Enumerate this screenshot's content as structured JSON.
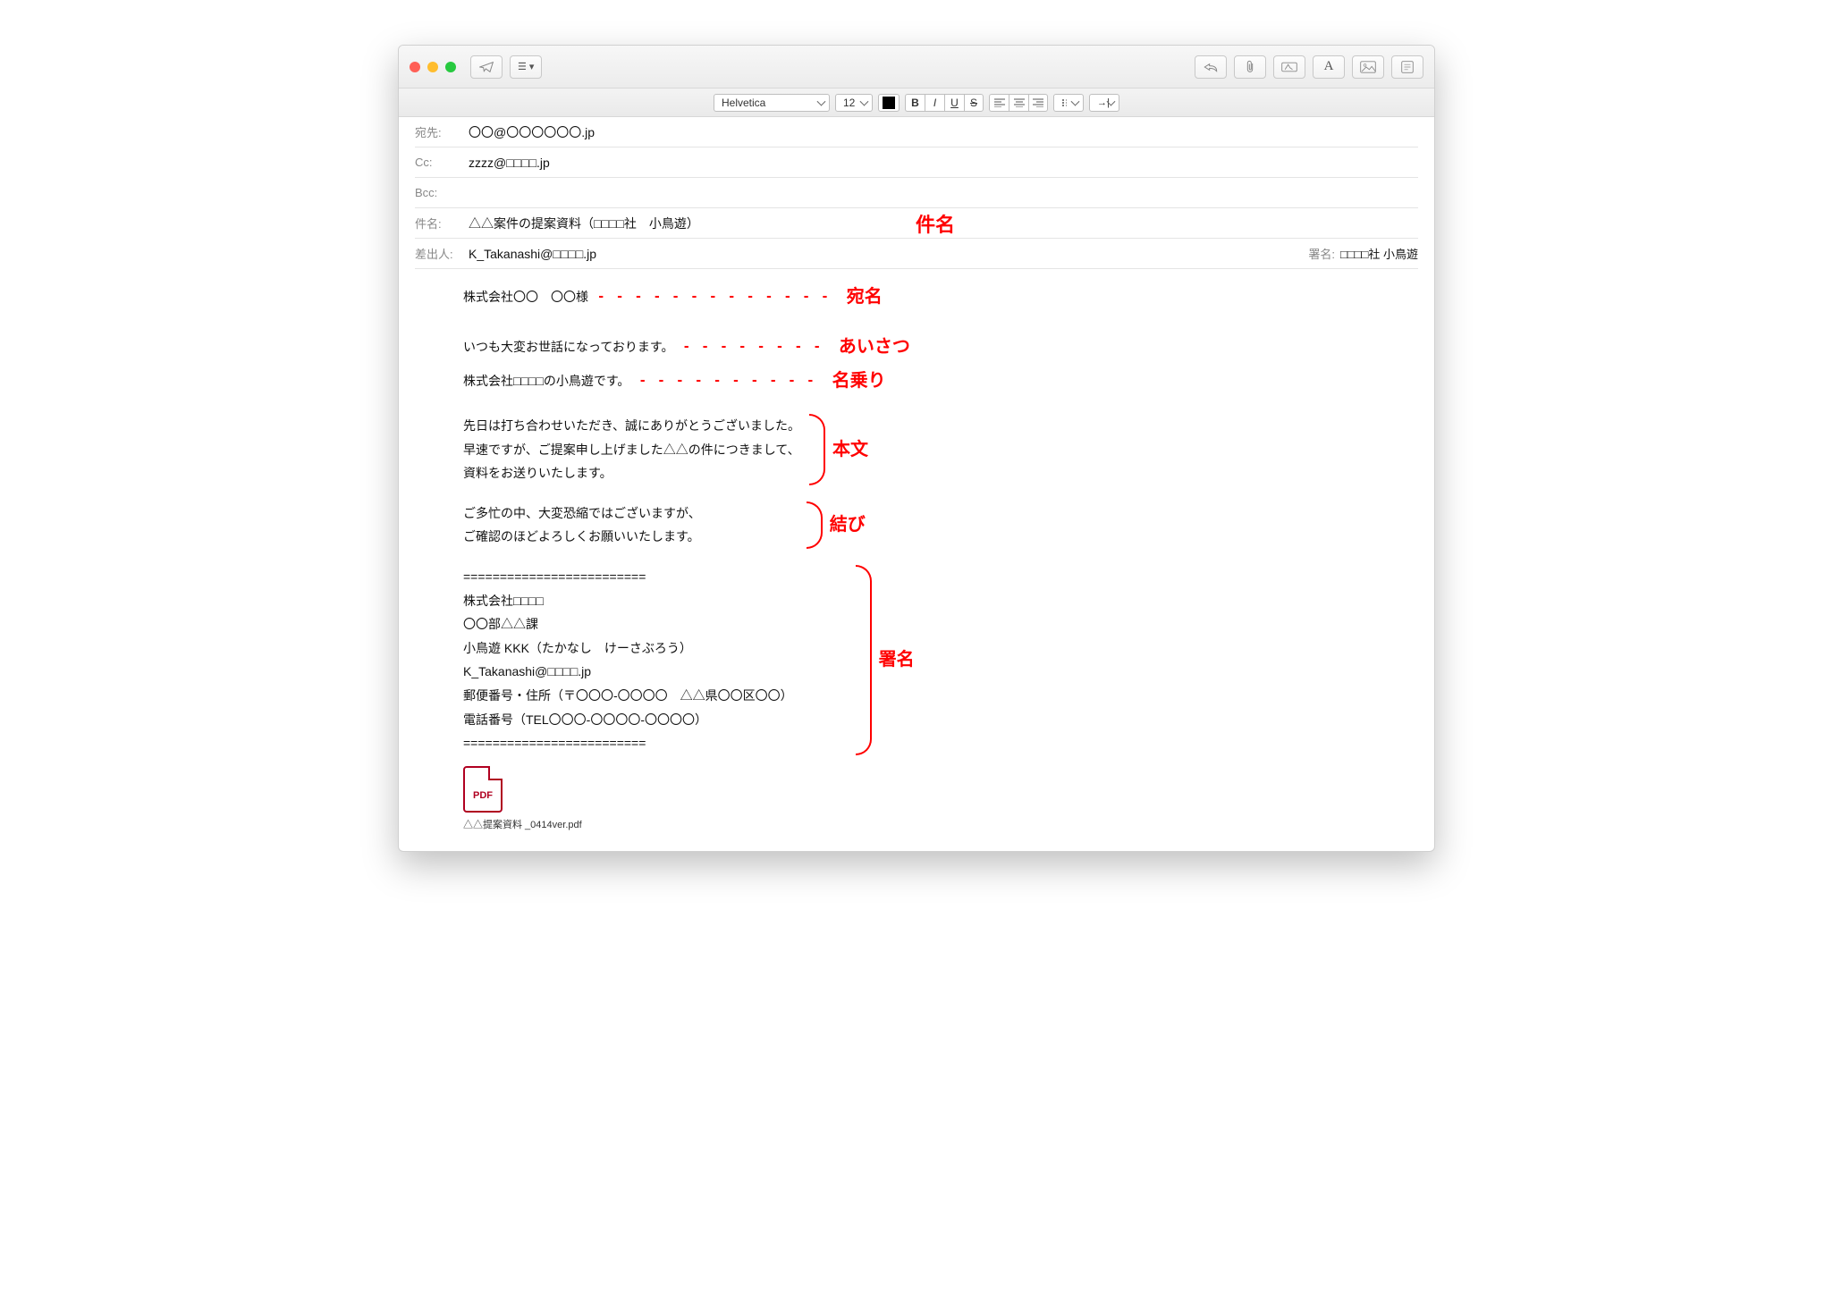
{
  "toolbar": {
    "font": "Helvetica",
    "size": "12",
    "bold": "B",
    "italic": "I",
    "underline": "U",
    "strike": "S"
  },
  "headers": {
    "to_label": "宛先:",
    "to_value": "〇〇@〇〇〇〇〇〇.jp",
    "cc_label": "Cc:",
    "cc_value": "zzzz@□□□□.jp",
    "bcc_label": "Bcc:",
    "bcc_value": "",
    "subject_label": "件名:",
    "subject_value": "△△案件の提案資料（□□□□社　小鳥遊）",
    "from_label": "差出人:",
    "from_value": "K_Takanashi@□□□□.jp",
    "signature_label": "署名:",
    "signature_value": "□□□□社 小鳥遊"
  },
  "annotations": {
    "subject": "件名",
    "addressee": "宛名",
    "greeting": "あいさつ",
    "self_intro": "名乗り",
    "body": "本文",
    "closing": "結び",
    "signature": "署名"
  },
  "body": {
    "addressee": "株式会社〇〇　〇〇様",
    "greeting": "いつも大変お世話になっております。",
    "self_intro": "株式会社□□□□の小鳥遊です。",
    "main1": "先日は打ち合わせいただき、誠にありがとうございました。",
    "main2": "早速ですが、ご提案申し上げました△△の件につきまして、",
    "main3": "資料をお送りいたします。",
    "closing1": "ご多忙の中、大変恐縮ではございますが、",
    "closing2": "ご確認のほどよろしくお願いいたします。",
    "sig_sep": "=========================",
    "sig1": "株式会社□□□□",
    "sig2": "〇〇部△△課",
    "sig3": "小鳥遊 KKK（たかなし　けーさぶろう）",
    "sig4": "K_Takanashi@□□□□.jp",
    "sig5": "郵便番号・住所（〒〇〇〇-〇〇〇〇　△△県〇〇区〇〇）",
    "sig6": "電話番号（TEL〇〇〇-〇〇〇〇-〇〇〇〇）"
  },
  "attachment": {
    "badge": "PDF",
    "filename": "△△提案資料 _0414ver.pdf"
  }
}
